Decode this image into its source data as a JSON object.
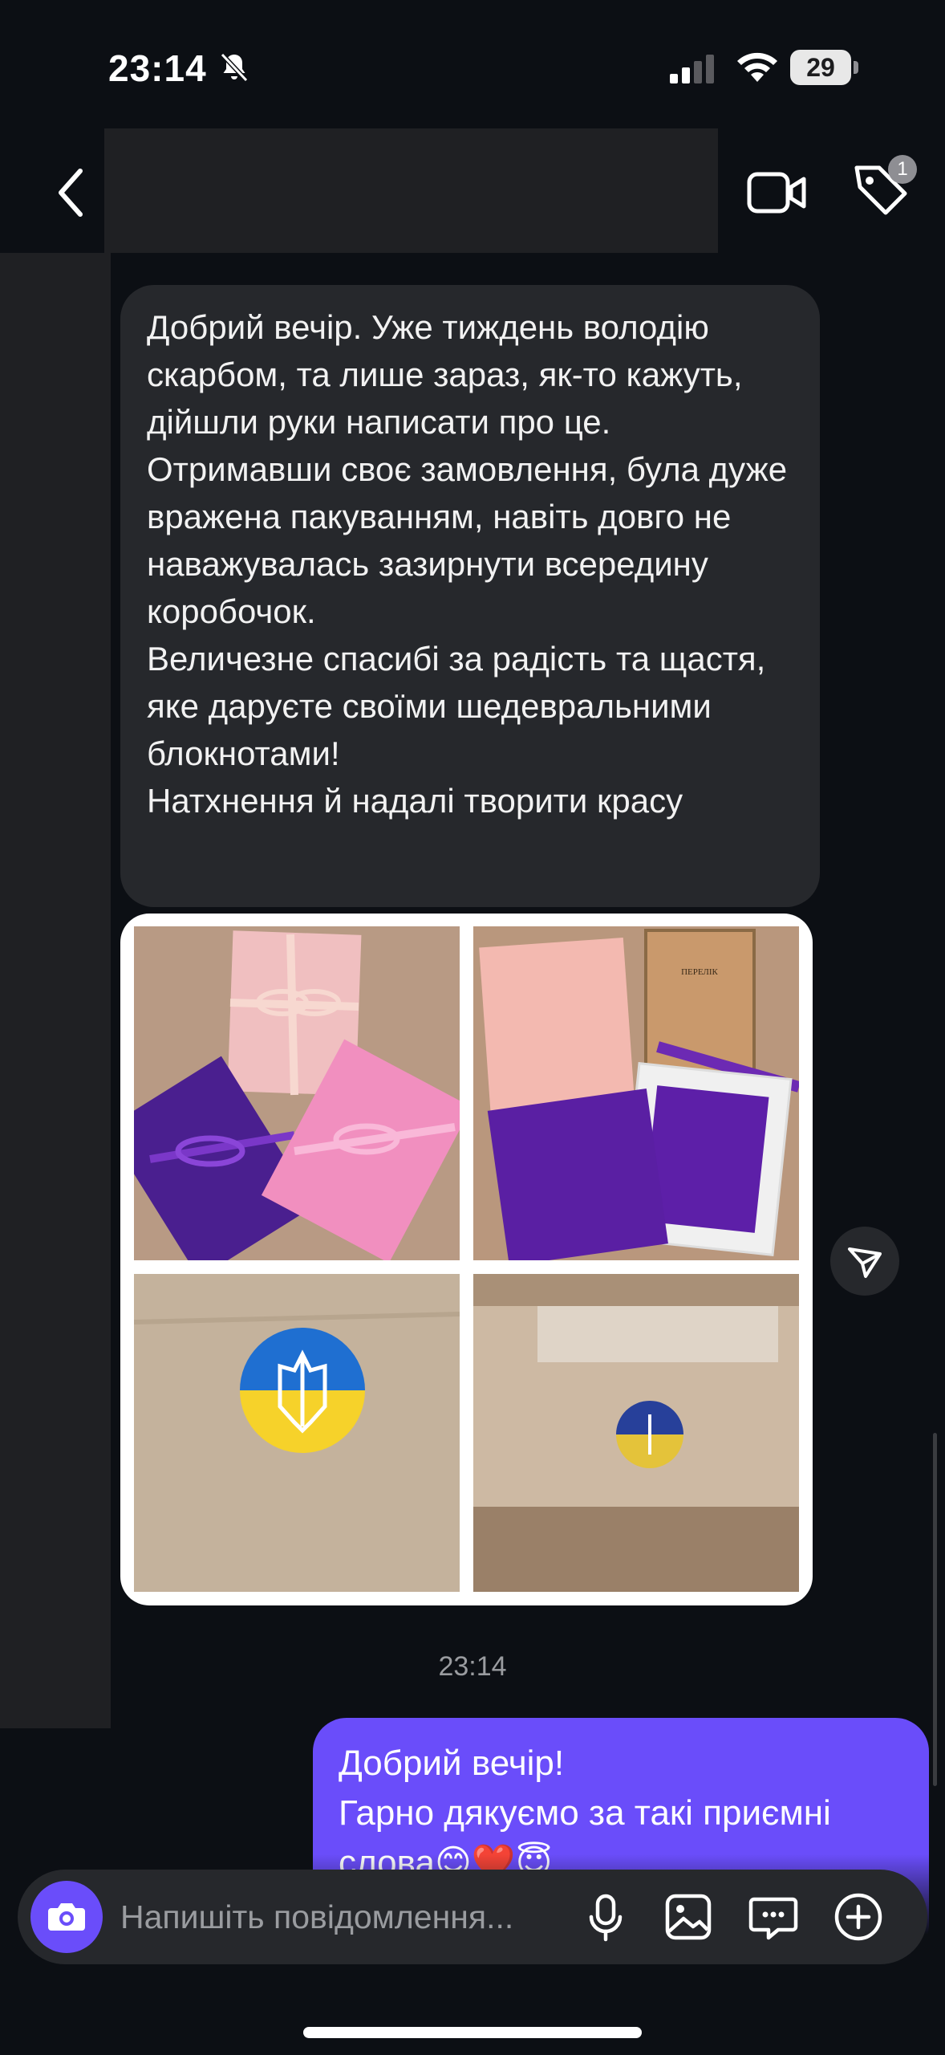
{
  "status_bar": {
    "time": "23:14",
    "battery_level": "29",
    "icons": [
      "bell-slash-icon",
      "cellular-signal-icon",
      "wifi-icon",
      "battery-icon"
    ]
  },
  "header": {
    "back_icon": "chevron-left-icon",
    "video_icon": "video-camera-icon",
    "tag_icon": "tag-icon",
    "tag_badge": "1"
  },
  "messages": {
    "incoming": {
      "paragraphs": [
        "Добрий вечір. Уже тиждень володію скарбом, та лише зараз, як-то кажуть, дійшли руки написати про це.",
        "Отримавши своє замовлення, була дуже вражена пакуванням, навіть довго не наважувалась зазирнути всередину коробочок.",
        "Величезне спасибі за радість та щастя, яке даруєте своїми шедевральними блокнотами!",
        "Натхнення й надалі творити красу"
      ]
    },
    "timestamp": "23:14",
    "outgoing": {
      "lines": [
        "Добрий вечір!",
        "Гарно дякуємо за такі приємні",
        "слова😊❤️😇"
      ]
    }
  },
  "composer": {
    "placeholder": "Напишіть повідомлення...",
    "icons": [
      "camera-icon",
      "microphone-icon",
      "gallery-icon",
      "sticker-icon",
      "add-icon"
    ]
  },
  "colors": {
    "background": "#0c0f14",
    "bubble_incoming": "#26282c",
    "bubble_outgoing": "#6a4dfa",
    "accent": "#6a4dfa"
  }
}
